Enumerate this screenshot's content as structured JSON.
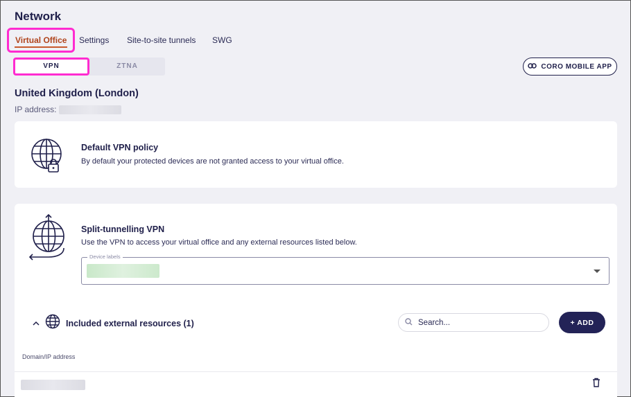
{
  "page": {
    "title": "Network"
  },
  "tabs": [
    {
      "label": "Virtual Office",
      "active": true
    },
    {
      "label": "Settings",
      "active": false
    },
    {
      "label": "Site-to-site tunnels",
      "active": false
    },
    {
      "label": "SWG",
      "active": false
    }
  ],
  "mode_toggle": {
    "vpn_label": "VPN",
    "ztna_label": "ZTNA",
    "selected": "VPN"
  },
  "mobile_app_button": {
    "label": "CORO MOBILE APP",
    "icon": "link-icon"
  },
  "location": {
    "name": "United Kingdom (London)",
    "ip_label": "IP address:"
  },
  "default_policy": {
    "title": "Default VPN policy",
    "description": "By default your protected devices are not granted access to your virtual office.",
    "icon": "globe-lock-icon"
  },
  "split_tunnelling": {
    "title": "Split-tunnelling VPN",
    "description": "Use the VPN to access your virtual office and any external resources listed below.",
    "icon": "globe-arrow-icon",
    "device_labels": {
      "label": "Device labels"
    }
  },
  "resources": {
    "title": "Included external resources (1)",
    "search_placeholder": "Search...",
    "add_label": "ADD",
    "column_header": "Domain/IP address"
  },
  "colors": {
    "accent": "#c85a2c",
    "brand": "#232357",
    "highlight": "#ff2bd0"
  }
}
